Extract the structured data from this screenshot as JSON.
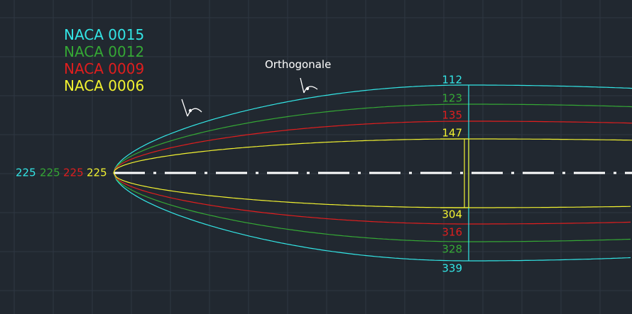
{
  "colors": {
    "background": "#212830",
    "grid": "#2e3742",
    "naca0015": "#33e6e6",
    "naca0012": "#35a835",
    "naca0009": "#e01e1e",
    "naca0006": "#f2f230",
    "white": "#ffffff"
  },
  "legend": [
    {
      "label": "NACA 0015",
      "color": "#33e6e6"
    },
    {
      "label": "NACA 0012",
      "color": "#35a835"
    },
    {
      "label": "NACA 0009",
      "color": "#e01e1e"
    },
    {
      "label": "NACA 0006",
      "color": "#f2f230"
    }
  ],
  "annotation": {
    "label": "Orthogonale"
  },
  "leading_edge_values": [
    "225",
    "225",
    "225",
    "225"
  ],
  "upper_values": [
    "112",
    "123",
    "135",
    "147"
  ],
  "lower_values": [
    "339",
    "328",
    "316",
    "304"
  ]
}
